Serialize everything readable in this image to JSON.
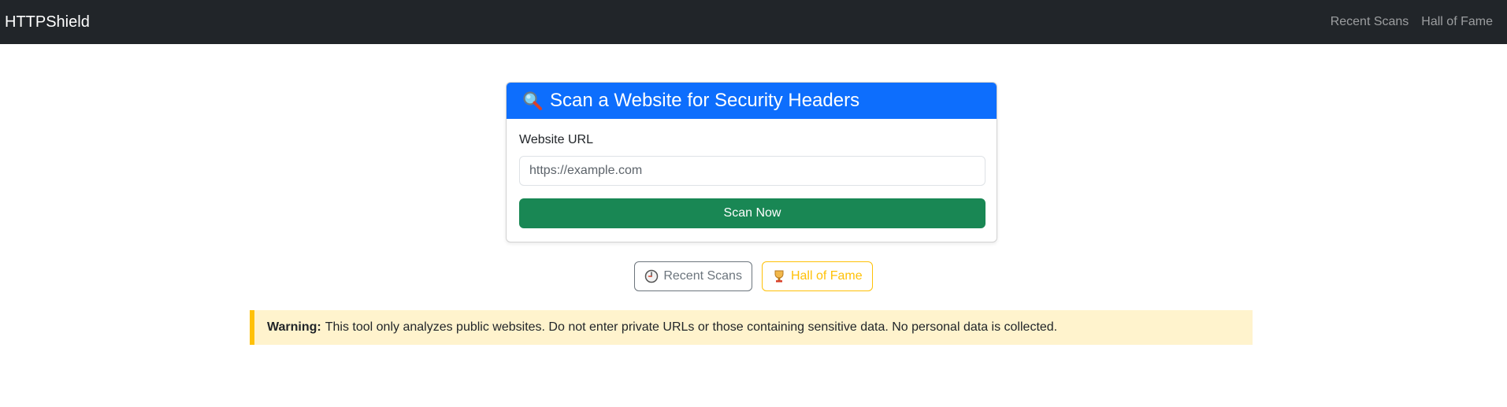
{
  "navbar": {
    "brand": "HTTPShield",
    "links": [
      {
        "label": "Recent Scans"
      },
      {
        "label": "Hall of Fame"
      }
    ]
  },
  "scan_card": {
    "header_icon": "magnifying-glass-icon",
    "title": "Scan a Website for Security Headers",
    "url_label": "Website URL",
    "url_value": "",
    "url_placeholder": "https://example.com",
    "submit_label": "Scan Now"
  },
  "actions": {
    "recent_scans": {
      "icon": "clock-icon",
      "label": "Recent Scans"
    },
    "hall_of_fame": {
      "icon": "trophy-icon",
      "label": "Hall of Fame"
    }
  },
  "warning": {
    "label": "Warning:",
    "text": "This tool only analyzes public websites. Do not enter private URLs or those containing sensitive data. No personal data is collected."
  },
  "colors": {
    "navbar_bg": "#212529",
    "primary": "#0d6efd",
    "success": "#198754",
    "secondary": "#6c757d",
    "warning": "#ffc107",
    "warning_bg": "#fff3cd"
  }
}
